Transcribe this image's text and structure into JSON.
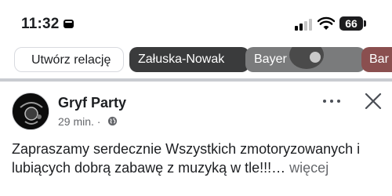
{
  "status_bar": {
    "time": "11:32",
    "battery": "66",
    "icons": [
      "message-icon",
      "signal-icon",
      "wifi-icon",
      "battery-icon"
    ]
  },
  "stories": {
    "items": [
      {
        "label": "Utwórz relację"
      },
      {
        "label": "Załuska-Nowak"
      },
      {
        "label": "Bayer"
      },
      {
        "label": "Bar"
      }
    ]
  },
  "post": {
    "author": "Gryf Party",
    "time": "29 min. ·",
    "text": "Zapraszamy serdecznie Wszystkich zmotoryzowanych i lubiących dobrą zabawę z muzyką w tle!!!…",
    "see_more": "więcej",
    "icons": [
      "globe-icon",
      "more-icon",
      "close-icon"
    ]
  },
  "colors": {
    "divider": "#c9ccd1",
    "secondary_text": "#65676b",
    "chip_dark": "#3a3b3c"
  }
}
